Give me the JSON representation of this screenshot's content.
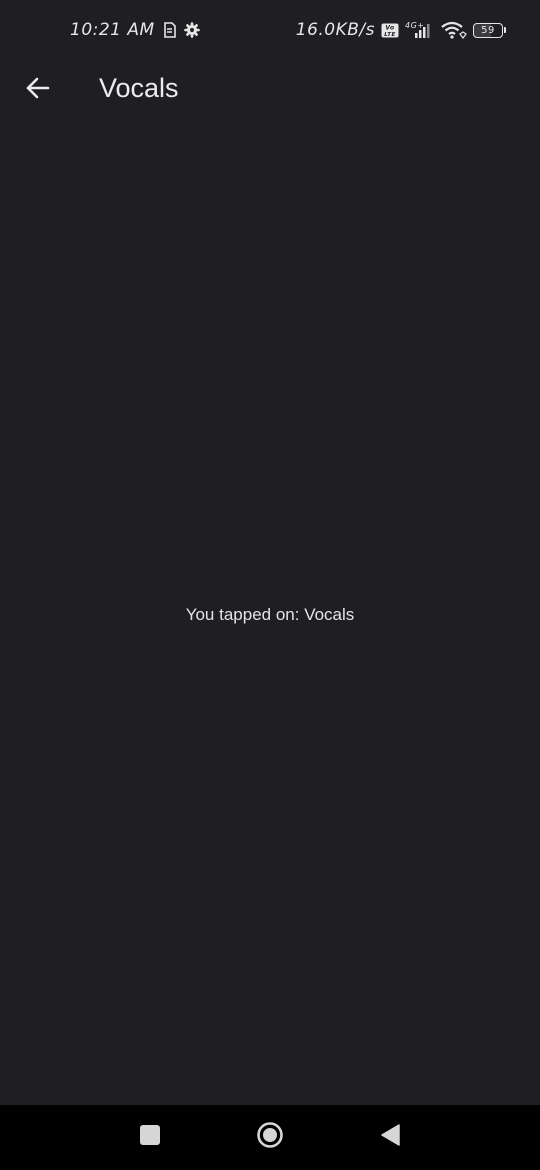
{
  "status_bar": {
    "time": "10:21 AM",
    "net_speed": "16.0KB/s",
    "network_type": "4G+",
    "battery_level": "59",
    "icons": [
      "sim-icon",
      "settings-gear-icon",
      "volte-icon",
      "signal-icon",
      "wifi-icon",
      "battery-icon"
    ]
  },
  "app_bar": {
    "title": "Vocals",
    "back_icon": "arrow-left-icon"
  },
  "body": {
    "message": "You tapped on: Vocals"
  },
  "nav_bar": {
    "icons": [
      "recents-square-icon",
      "home-circle-icon",
      "back-triangle-icon"
    ]
  },
  "colors": {
    "background": "#1f1e23",
    "text": "#e9e9ec",
    "nav_background": "#000000"
  }
}
